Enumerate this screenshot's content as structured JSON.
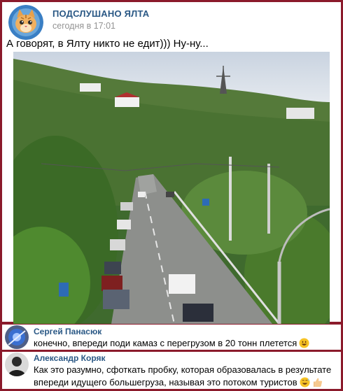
{
  "post": {
    "group_name": "ПОДСЛУШАНО ЯЛТА",
    "time": "сегодня в 17:01",
    "text": "А говорят, в Ялту никто не едит)))  Ну-ну..."
  },
  "comments": [
    {
      "author": "Сергей Панасюк",
      "text": "конечно, впереди поди камаз с перегрузом в 20 тонн плетется",
      "emoji": [
        "grinning-face-icon"
      ]
    },
    {
      "author": "Александр Коряк",
      "text": "Как это разумно, сфоткать пробку, которая образовалась в результате впереди идущего большегруза, называя это потоком туристов",
      "emoji": [
        "grinning-sweat-face-icon",
        "thumbs-up-icon"
      ]
    }
  ],
  "colors": {
    "frame": "#8b1a2b",
    "link": "#2a5885",
    "muted": "#939393"
  }
}
